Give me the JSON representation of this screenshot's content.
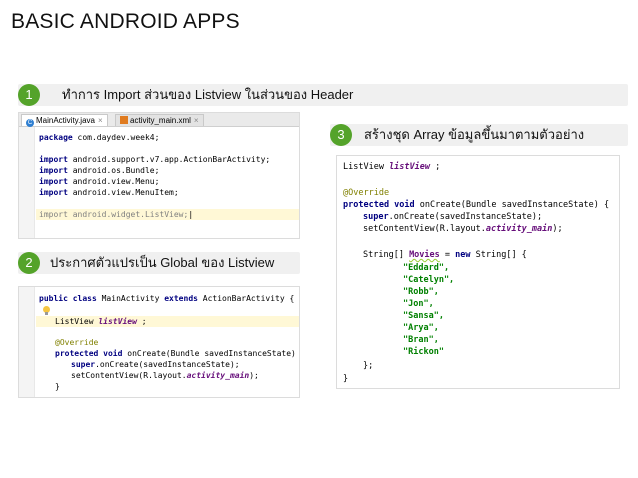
{
  "title": "BASIC ANDROID APPS",
  "steps": [
    {
      "num": "1",
      "text": "ทำการ Import ส่วนของ Listview ในส่วนของ Header"
    },
    {
      "num": "2",
      "text": "ประกาศตัวแปรเป็น Global ของ Listview"
    },
    {
      "num": "3",
      "text": "สร้างชุด Array ข้อมูลขึ้นมาตามตัวอย่าง"
    }
  ],
  "panel1": {
    "tabs": [
      {
        "label": "MainActivity.java",
        "icon": "class-c-icon"
      },
      {
        "label": "activity_main.xml",
        "icon": "xml-file-icon"
      }
    ],
    "code": {
      "package_kw": "package",
      "package_name": " com.daydev.week4;",
      "import_kw": "import",
      "imports": [
        " android.support.v7.app.ActionBarActivity;",
        " android.os.Bundle;",
        " android.view.Menu;",
        " android.view.MenuItem;"
      ],
      "listview_import": " android.widget.ListView;"
    }
  },
  "panel2": {
    "line1_kw": "public class",
    "line1_name": " MainActivity ",
    "line1_ext": "extends",
    "line1_rest": " ActionBarActivity {",
    "field_type": "ListView ",
    "field_name": "listView",
    "field_end": " ;",
    "override": "@Override",
    "oncreate_kw": "protected void",
    "oncreate_rest": " onCreate(Bundle savedInstanceState) {",
    "super_kw": "super",
    "super_rest": ".onCreate(savedInstanceState);",
    "setcv": "setContentView(R.layout.",
    "setcv_field": "activity_main",
    "setcv_end": ");",
    "close": "}"
  },
  "panel3": {
    "line1_type": "ListView ",
    "line1_name": "listView",
    "line1_end": " ;",
    "override": "@Override",
    "oncreate_kw": "protected void",
    "oncreate_rest": " onCreate(Bundle savedInstanceState) {",
    "super_kw": "super",
    "super_rest": ".onCreate(savedInstanceState);",
    "setcv": "setContentView(R.layout.",
    "setcv_field": "activity_main",
    "setcv_end": ");",
    "array_start": "String[] ",
    "array_name": "Movies",
    "array_mid": " = ",
    "array_new": "new",
    "array_rest": " String[] {",
    "items": [
      "\"Eddard\",",
      "\"Catelyn\",",
      "\"Robb\",",
      "\"Jon\",",
      "\"Sansa\",",
      "\"Arya\",",
      "\"Bran\",",
      "\"Rickon\""
    ],
    "array_close": "};",
    "close": "}"
  },
  "colors": {
    "step_circle": "#54a32a",
    "step_bar": "#f0f0f0",
    "keyword": "#000080",
    "string": "#008000",
    "field": "#660e7a",
    "annotation": "#808000"
  }
}
